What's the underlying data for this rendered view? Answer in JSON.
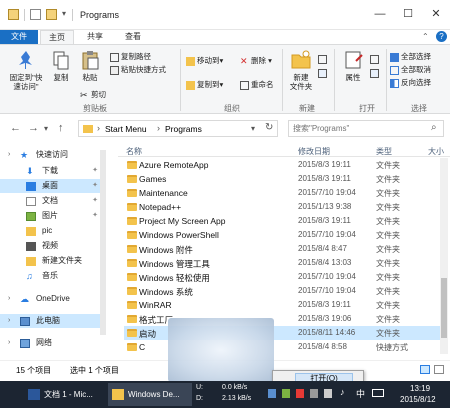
{
  "window": {
    "title": "Programs",
    "minimize": "—",
    "maximize": "☐",
    "close": "✕",
    "help": "?"
  },
  "ribbon_tabs": [
    "文件",
    "主页",
    "共享",
    "查看"
  ],
  "ribbon": {
    "clipboard": {
      "pin_quick_access": "固定到\"快\n速访问\"",
      "copy": "复制",
      "paste": "粘贴",
      "cut": "剪切",
      "copy_path": "复制路径",
      "paste_shortcut": "粘贴快捷方式",
      "label": "剪贴板"
    },
    "organize": {
      "move_to": "移动到▾",
      "copy_to": "复制到▾",
      "delete": "删除 ▾",
      "rename": "重命名",
      "label": "组织"
    },
    "new": {
      "new_folder": "新建\n文件夹",
      "label": "新建"
    },
    "open": {
      "properties": "属性",
      "label": "打开"
    },
    "select": {
      "select_all": "全部选择",
      "select_none": "全部取消",
      "invert": "反向选择",
      "label": "选择"
    }
  },
  "address": {
    "back": "←",
    "forward": "→",
    "dropdown": "▾",
    "up": "↑",
    "path": [
      "Start Menu",
      "Programs"
    ],
    "separator": "›",
    "refresh": "↻"
  },
  "search": {
    "placeholder": "搜索\"Programs\"",
    "icon": "⌕"
  },
  "nav_pane": [
    {
      "label": "快速访问",
      "icon": "star",
      "pinned": false
    },
    {
      "label": "下载",
      "icon": "download",
      "pinned": true
    },
    {
      "label": "桌面",
      "icon": "desktop",
      "pinned": true
    },
    {
      "label": "文档",
      "icon": "document",
      "pinned": true
    },
    {
      "label": "图片",
      "icon": "picture",
      "pinned": true
    },
    {
      "label": "pic",
      "icon": "folder",
      "pinned": false
    },
    {
      "label": "视频",
      "icon": "video",
      "pinned": false
    },
    {
      "label": "新建文件夹",
      "icon": "folder",
      "pinned": false
    },
    {
      "label": "音乐",
      "icon": "music",
      "pinned": false
    },
    {
      "label": "OneDrive",
      "icon": "cloud",
      "pinned": false
    },
    {
      "label": "此电脑",
      "icon": "computer",
      "pinned": false
    },
    {
      "label": "网络",
      "icon": "network",
      "pinned": false
    }
  ],
  "pin_glyph": "✦",
  "columns": {
    "name": "名称",
    "date": "修改日期",
    "type": "类型",
    "size": "大小"
  },
  "files": [
    {
      "name": "Azure RemoteApp",
      "date": "2015/8/3 19:11",
      "type": "文件夹"
    },
    {
      "name": "Games",
      "date": "2015/8/3 19:11",
      "type": "文件夹"
    },
    {
      "name": "Maintenance",
      "date": "2015/7/10 19:04",
      "type": "文件夹"
    },
    {
      "name": "Notepad++",
      "date": "2015/1/13 9:38",
      "type": "文件夹"
    },
    {
      "name": "Project My Screen App",
      "date": "2015/8/3 19:11",
      "type": "文件夹"
    },
    {
      "name": "Windows PowerShell",
      "date": "2015/7/10 19:04",
      "type": "文件夹"
    },
    {
      "name": "Windows 附件",
      "date": "2015/8/4 8:47",
      "type": "文件夹"
    },
    {
      "name": "Windows 管理工具",
      "date": "2015/8/4 13:03",
      "type": "文件夹"
    },
    {
      "name": "Windows 轻松使用",
      "date": "2015/7/10 19:04",
      "type": "文件夹"
    },
    {
      "name": "Windows 系统",
      "date": "2015/7/10 19:04",
      "type": "文件夹"
    },
    {
      "name": "WinRAR",
      "date": "2015/8/3 19:11",
      "type": "文件夹"
    },
    {
      "name": "格式工厂",
      "date": "2015/8/3 19:06",
      "type": "文件夹"
    },
    {
      "name": "启动",
      "date": "2015/8/11 14:46",
      "type": "文件夹",
      "selected": true
    },
    {
      "name": "C",
      "date": "2015/8/4 8:58",
      "type": "快捷方式"
    }
  ],
  "status": {
    "count": "15 个项目",
    "selected": "选中 1 个项目"
  },
  "context_menu": {
    "open": "打开(O)"
  },
  "taskbar": {
    "app1": "文档 1 - Mic...",
    "app2": "Windows De...",
    "net_up_label": "U:",
    "net_up": "0.0 kB/s",
    "net_down_label": "D:",
    "net_down": "2.13 kB/s",
    "ime": "中",
    "time": "13:19",
    "date": "2015/8/12"
  },
  "colors": {
    "accent": "#1a6fc4",
    "folder": "#f3c34c",
    "selected_row": "#cce8ff",
    "taskbar": "#1c2532"
  }
}
